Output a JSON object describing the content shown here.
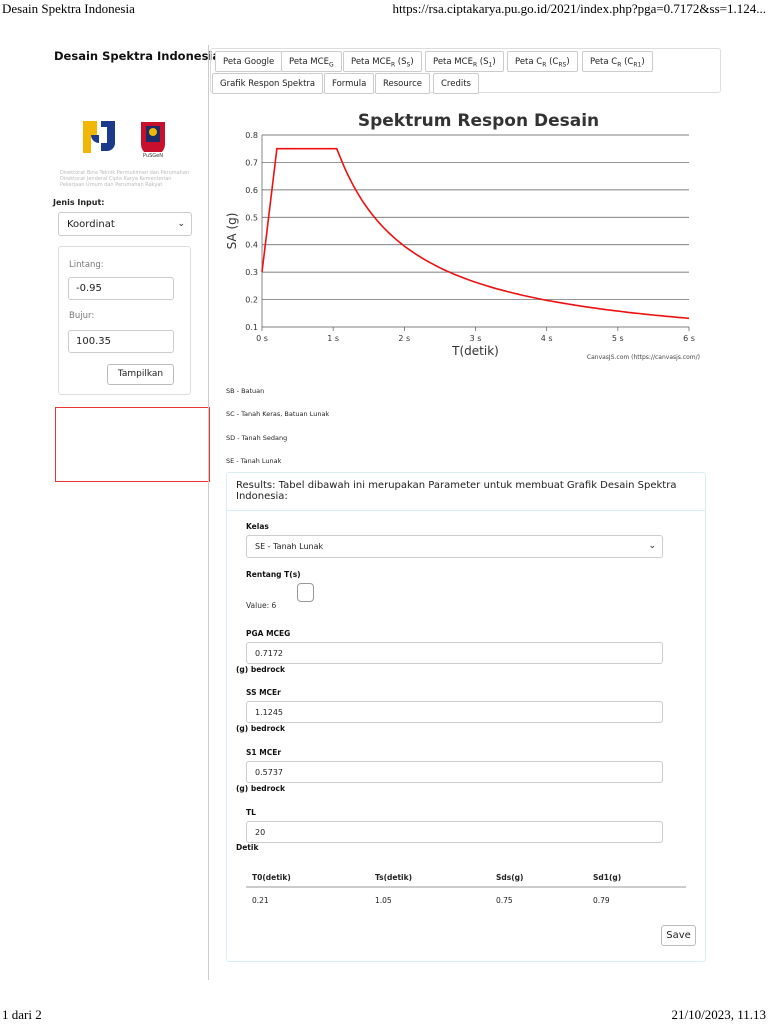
{
  "browser": {
    "page_title": "Desain Spektra Indonesia",
    "url": "https://rsa.ciptakarya.pu.go.id/2021/index.php?pga=0.7172&ss=1.124...",
    "page_indicator": "1 dari 2",
    "timestamp": "21/10/2023, 11.13"
  },
  "sidebar": {
    "title": "Desain Spektra Indonesia",
    "caption": "Direktorat Bina Teknik Permukiman dan Perumahan Direktorat Jenderal Cipta Karya Kementerian Pekerjaan Umum dan Perumahan Rakyat",
    "jenis_input_label": "Jenis Input:",
    "jenis_input_value": "Koordinat",
    "lintang_label": "Lintang:",
    "lintang_value": "-0.95",
    "bujur_label": "Bujur:",
    "bujur_value": "100.35",
    "submit_label": "Tampilkan"
  },
  "tabs": [
    {
      "label": "Peta Google"
    },
    {
      "label": "Peta MCE",
      "sub": "G"
    },
    {
      "label": "Peta MCE",
      "sub": "R",
      "suffix": " (S",
      "sub2": "S",
      "end": ")"
    },
    {
      "label": "Peta MCE",
      "sub": "R",
      "suffix": " (S",
      "sub2": "1",
      "end": ")"
    },
    {
      "label": "Peta C",
      "sub": "R",
      "suffix": " (C",
      "sub2": "RS",
      "end": ")"
    },
    {
      "label": "Peta C",
      "sub": "R",
      "suffix": " (C",
      "sub2": "R1",
      "end": ")"
    },
    {
      "label": "Grafik Respon Spektra"
    },
    {
      "label": "Formula"
    },
    {
      "label": "Resource"
    },
    {
      "label": "Credits"
    }
  ],
  "chart_data": {
    "type": "line",
    "title": "Spektrum Respon Desain",
    "xlabel": "T(detik)",
    "ylabel": "SA (g)",
    "xlim": [
      0,
      6
    ],
    "ylim": [
      0.1,
      0.8
    ],
    "x_ticks": [
      "0 s",
      "1 s",
      "2 s",
      "3 s",
      "4 s",
      "5 s",
      "6 s"
    ],
    "y_ticks": [
      "0.1",
      "0.2",
      "0.3",
      "0.4",
      "0.5",
      "0.6",
      "0.7",
      "0.8"
    ],
    "grid": true,
    "credit": "CanvasJS.com (https://canvasjs.com/)",
    "series": [
      {
        "color": "#ee1111",
        "T0": 0.21,
        "Ts": 1.05,
        "Sds": 0.75,
        "Sd1": 0.79,
        "PGA_start": 0.3
      }
    ]
  },
  "site_classes": [
    "SB - Batuan",
    "SC - Tanah Keras, Batuan Lunak",
    "SD - Tanah Sedang",
    "SE - Tanah Lunak"
  ],
  "results": {
    "title": "Results: Tabel dibawah ini merupakan Parameter untuk membuat Grafik Desain Spektra Indonesia:",
    "kelas_label": "Kelas",
    "kelas_value": "SE - Tanah Lunak",
    "rentang_label": "Rentang T(s)",
    "rentang_value": "Value: 6",
    "pga_label": "PGA MCEG",
    "pga_value": "0.7172",
    "pga_unit": "(g) bedrock",
    "ss_label": "SS MCEr",
    "ss_value": "1.1245",
    "ss_unit": "(g) bedrock",
    "s1_label": "S1 MCEr",
    "s1_value": "0.5737",
    "s1_unit": "(g) bedrock",
    "tl_label": "TL",
    "tl_value": "20",
    "tl_unit": "Detik",
    "table_headers": [
      "T0(detik)",
      "Ts(detik)",
      "Sds(g)",
      "Sd1(g)"
    ],
    "table_values": [
      "0.21",
      "1.05",
      "0.75",
      "0.79"
    ],
    "save_label": "Save"
  }
}
